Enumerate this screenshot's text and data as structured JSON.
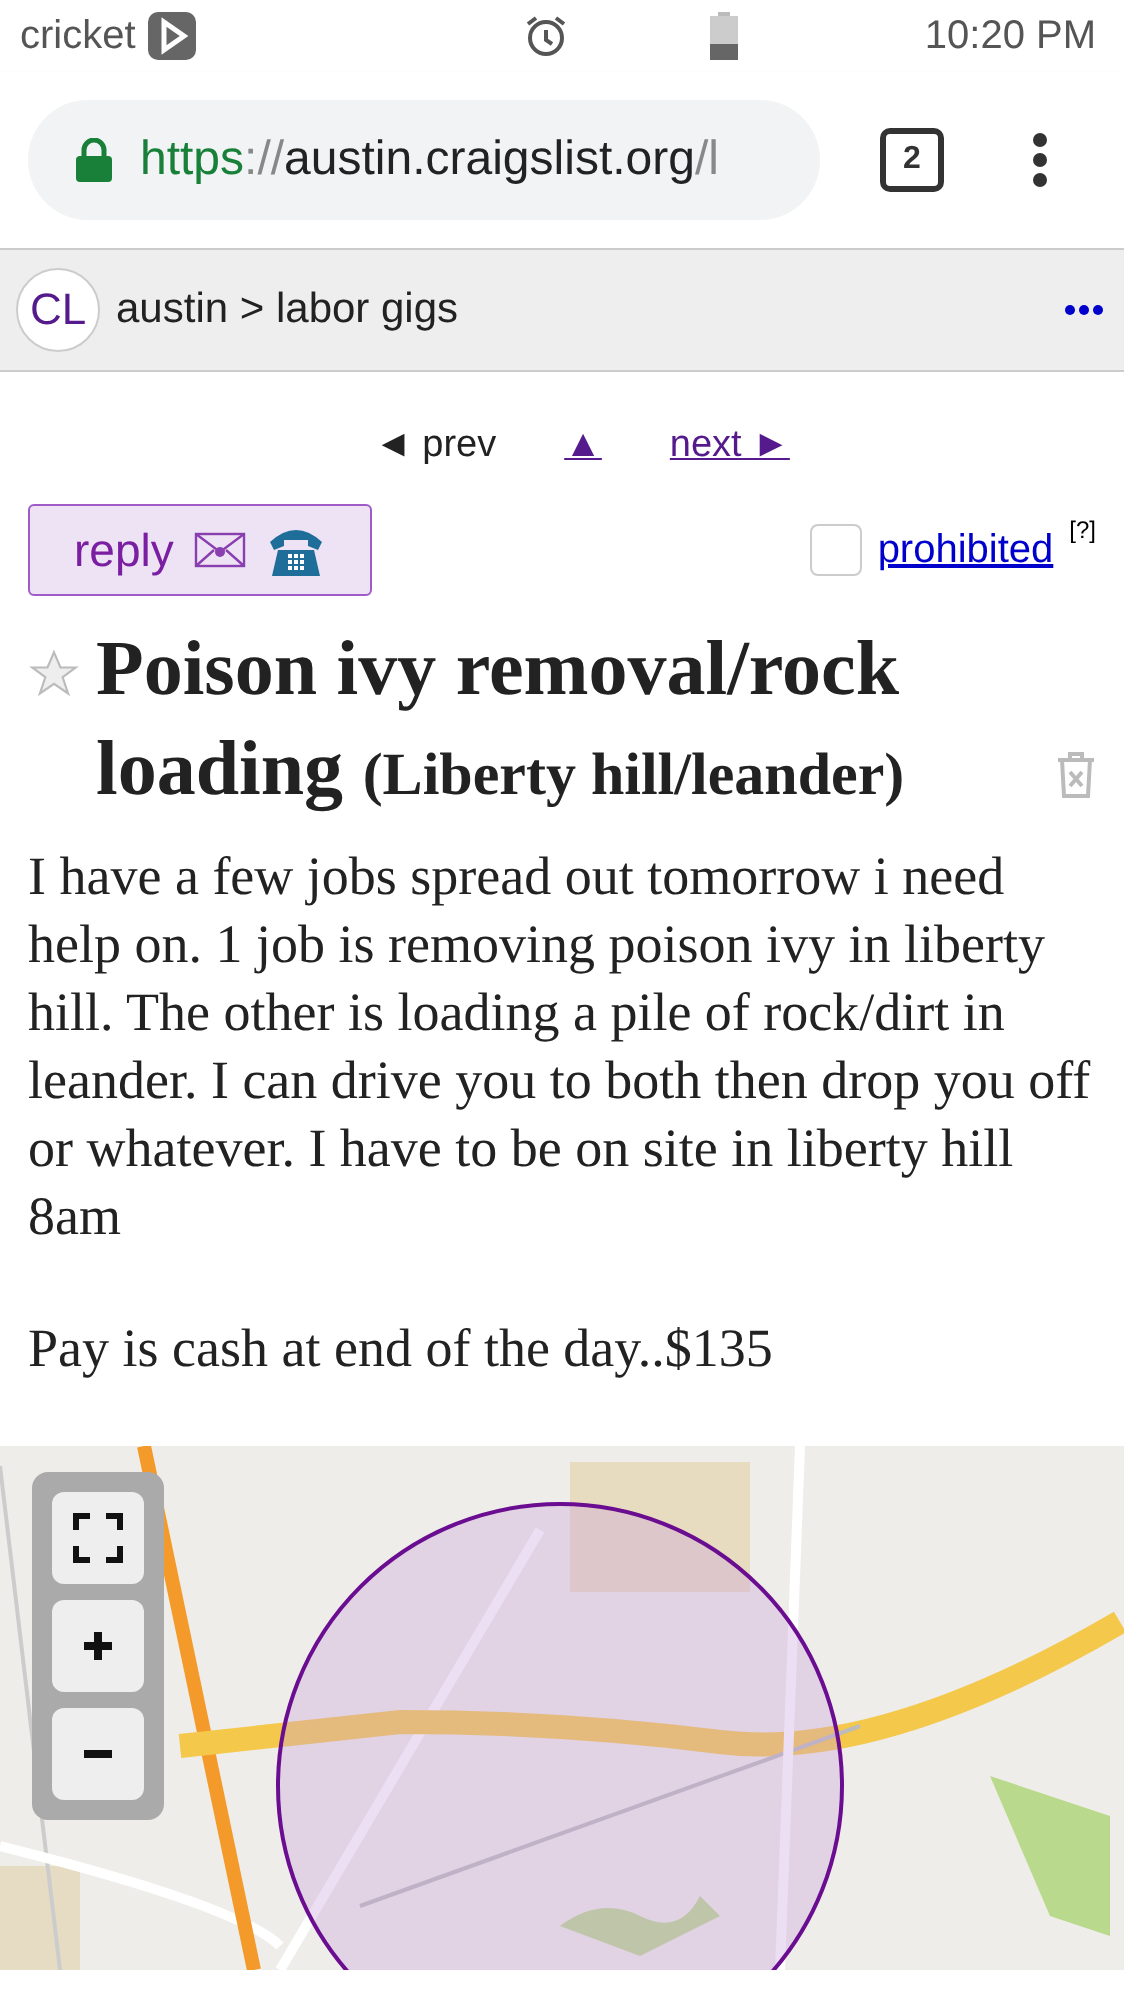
{
  "status_bar": {
    "carrier": "cricket",
    "time": "10:20 PM"
  },
  "browser": {
    "url": {
      "scheme": "https",
      "separator": "://",
      "host": "austin.craigslist.org",
      "path": "/l"
    },
    "tab_count": "2"
  },
  "header": {
    "logo": "CL",
    "breadcrumb": "austin > labor gigs"
  },
  "nav": {
    "prev": "◄ prev",
    "up": "▲",
    "next": "next ►"
  },
  "actions": {
    "reply": "reply",
    "flag": {
      "checked": false,
      "label": "prohibited",
      "help": "[?]"
    }
  },
  "posting": {
    "favorite": false,
    "title": "Poison ivy removal/rock loading",
    "location": "(Liberty hill/leander)",
    "body": [
      "I have a few jobs spread out tomorrow i need help on. 1 job is removing poison ivy in liberty hill. The other is loading a pile of rock/dirt in leander. I can drive you to both then drop you off or whatever. I have to be on site in liberty hill 8am",
      "Pay is cash at end of the day..$135"
    ]
  }
}
